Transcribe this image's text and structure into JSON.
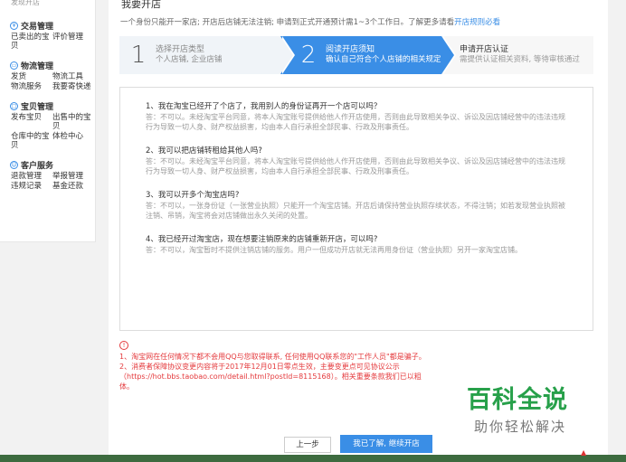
{
  "sidebar": {
    "top_text": "发现开店",
    "sections": [
      {
        "title": "交易管理",
        "icon": "transaction-icon",
        "items": [
          "已卖出的宝贝",
          "评价管理"
        ]
      },
      {
        "title": "物流管理",
        "icon": "logistics-icon",
        "items": [
          "发货",
          "物流工具",
          "物流服务",
          "我要寄快递"
        ]
      },
      {
        "title": "宝贝管理",
        "icon": "goods-icon",
        "items": [
          "发布宝贝",
          "出售中的宝贝",
          "仓库中的宝贝",
          "体检中心"
        ]
      },
      {
        "title": "客户服务",
        "icon": "customer-service-icon",
        "items": [
          "退款管理",
          "举报管理",
          "违规记录",
          "基金还款"
        ]
      }
    ]
  },
  "main": {
    "title": "我要开店",
    "intro_text": "一个身份只能开一家店; 开店后店铺无法注销; 申请到正式开通预计需1~3个工作日。了解更多请看",
    "intro_link": "开店规则必看",
    "steps": [
      {
        "num": "1",
        "title": "选择开店类型",
        "desc": "个人店铺, 企业店铺"
      },
      {
        "num": "2",
        "title": "阅读开店须知",
        "desc": "确认自己符合个人店铺的相关规定"
      },
      {
        "num": "",
        "title": "申请开店认证",
        "desc": "需提供认证相关资料, 等待审核通过"
      }
    ],
    "faq": [
      {
        "q": "1、我在淘宝已经开了个店了，我用别人的身份证再开一个店可以吗？",
        "a": "答：不可以。未经淘宝平台同意，将本人淘宝账号提供给他人作开店使用，否则由此导致相关争议、诉讼及因店铺经营中的违法违规行为导致一切人身、财产权益损害，均由本人自行承担全部民事、行政及刑事责任。"
      },
      {
        "q": "2、我可以把店铺转租给其他人吗?",
        "a": "答：不可以。未经淘宝平台同意，将本人淘宝账号提供给他人作开店使用，否则由此导致相关争议、诉讼及因店铺经营中的违法违规行为导致一切人身、财产权益损害，均由本人自行承担全部民事、行政及刑事责任。"
      },
      {
        "q": "3、我可以开多个淘宝店吗?",
        "a": "答：不可以，一张身份证（一张营业执照）只能开一个淘宝店铺。开店后请保持营业执照存续状态，不得注销；如若发现营业执照被注销、吊销，淘宝将会对店铺做出永久关闭的处置。"
      },
      {
        "q": "4、我已经开过淘宝店，现在想要注销原来的店铺重新开店，可以吗?",
        "a": "答：不可以，淘宝暂时不提供注销店铺的服务。用户一但成功开店就无法再用身份证（营业执照）另开一家淘宝店铺。"
      }
    ],
    "notices": [
      "1、淘宝网在任何情况下都不会用QQ与您取得联系, 任何使用QQ联系您的\"工作人员\"都是骗子。",
      "2、消费者保障协议变更内容将于2017年12月01日零点生效，主要变更点可见协议公示",
      "（https://hot.bbs.taobao.com/detail.html?postId=8115168）。相关重要条款我们已以粗",
      "体。"
    ],
    "prev_button": "上一步",
    "next_button": "我已了解, 继续开店"
  },
  "watermark": {
    "big": "百科全说",
    "small": "助你轻松解决"
  },
  "colors": {
    "accent": "#3a8ee6",
    "warning": "#e4393c",
    "watermark_green": "#27a04a"
  }
}
